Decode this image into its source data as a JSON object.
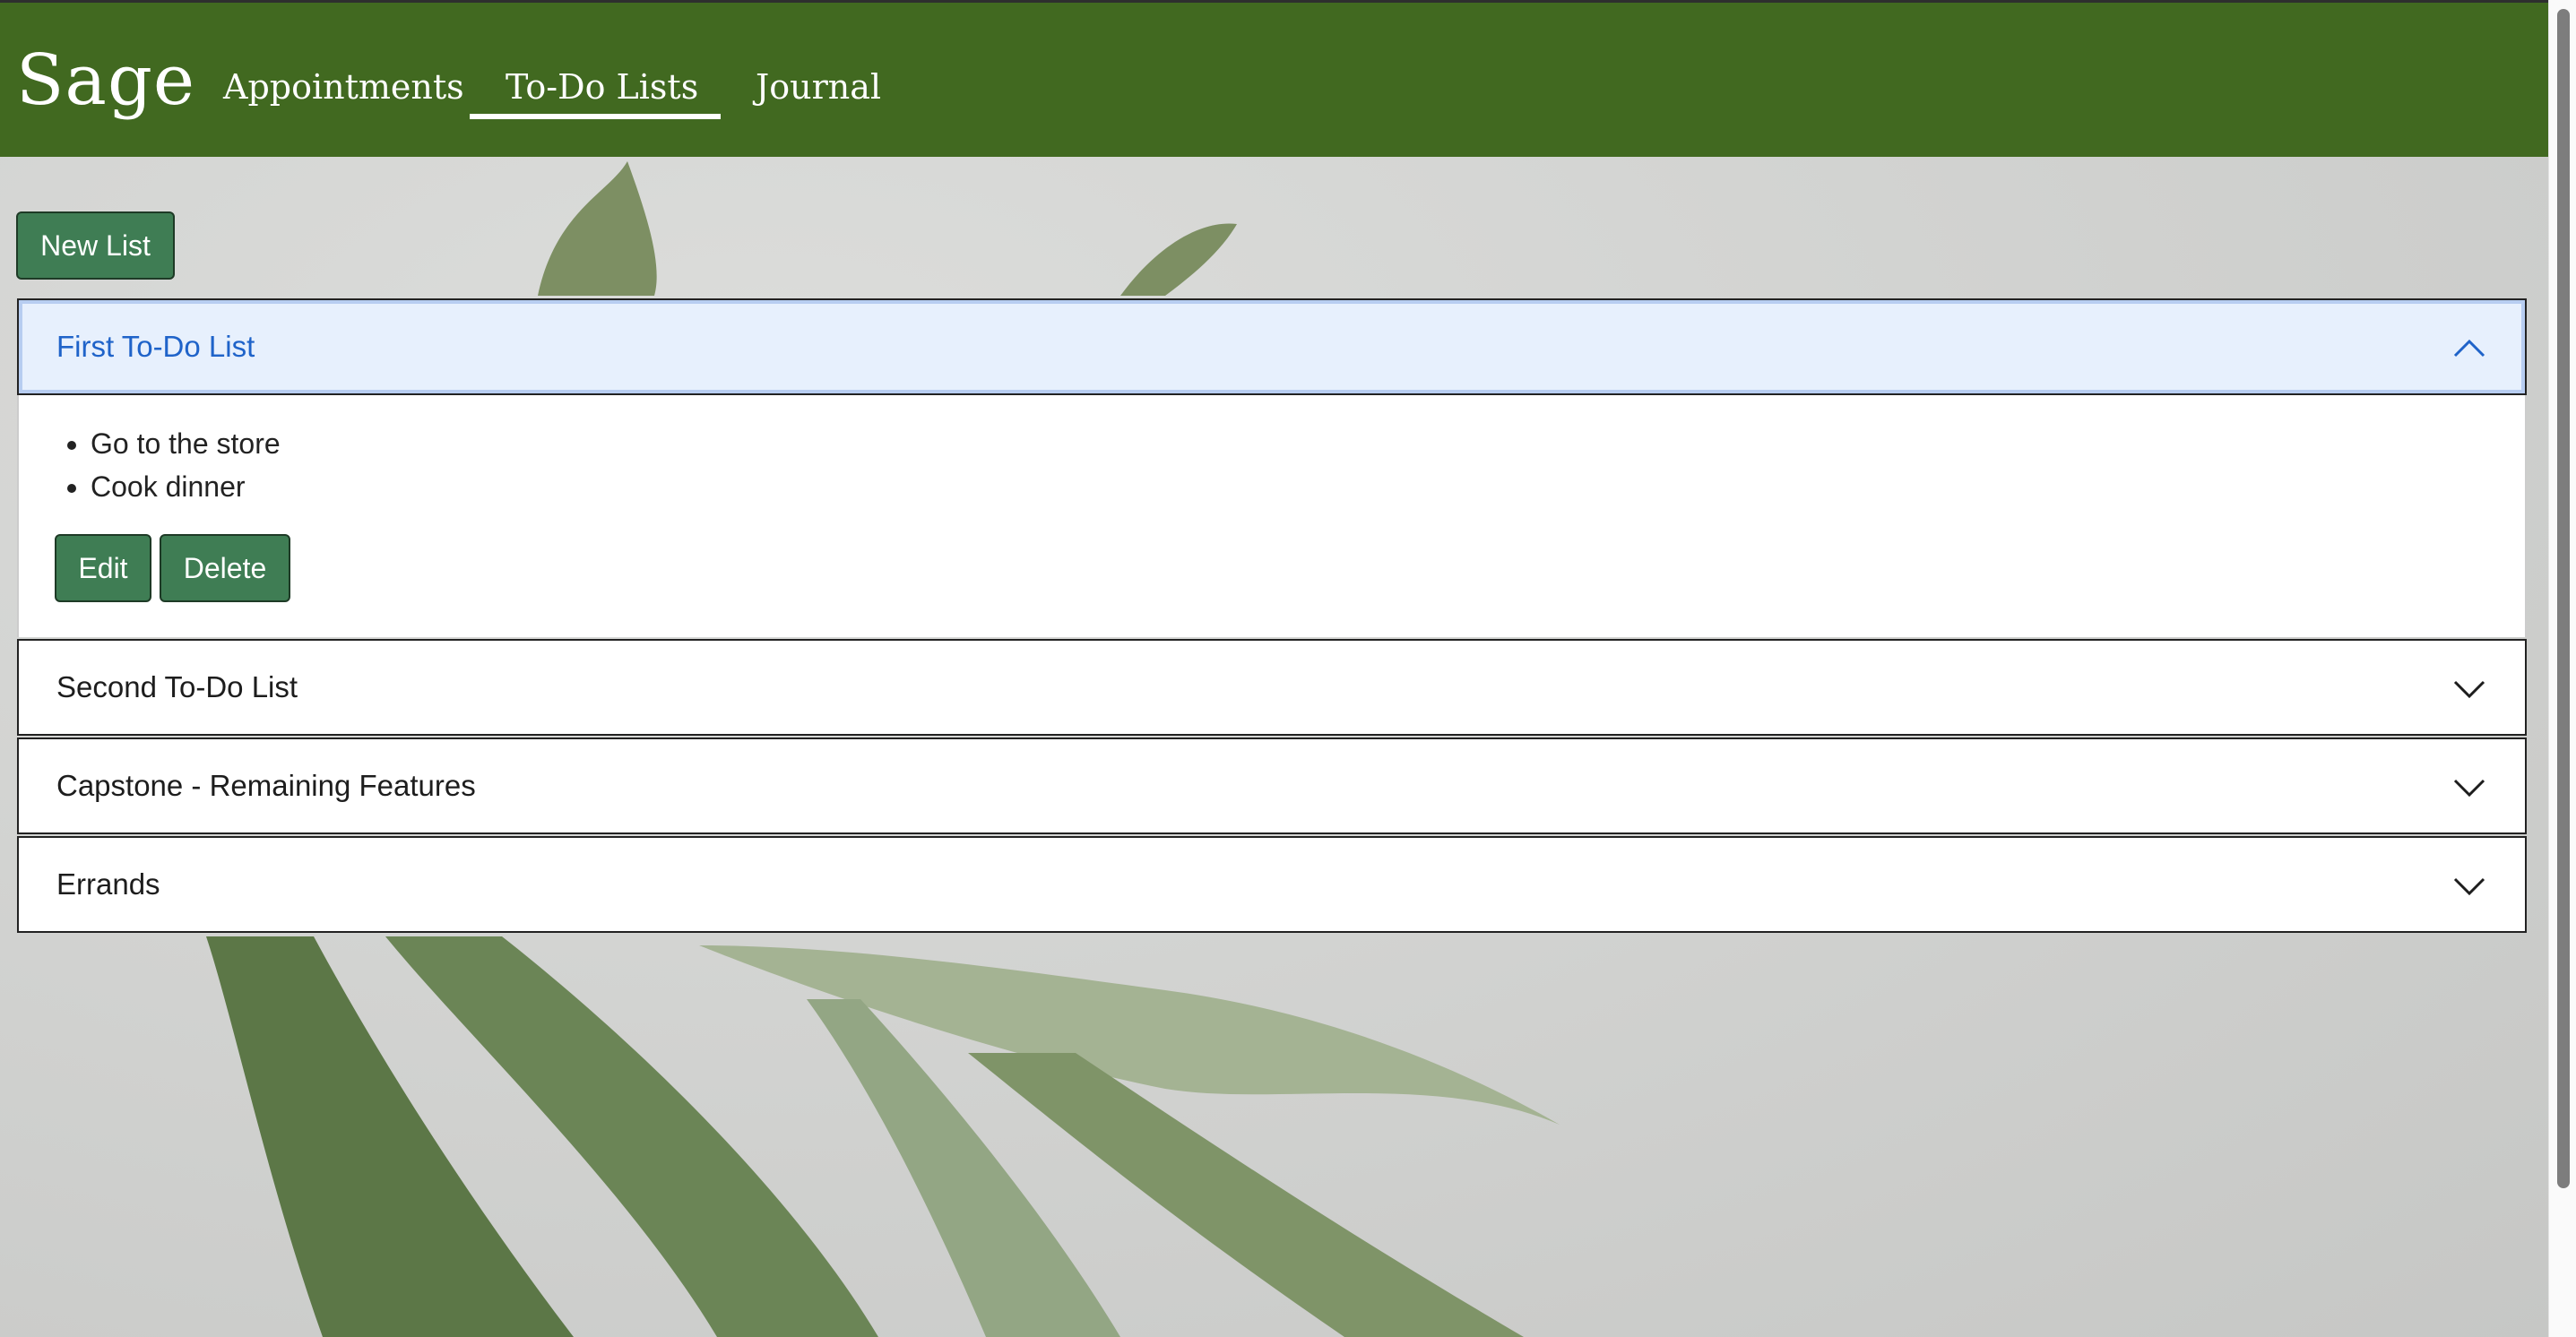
{
  "app": {
    "brand": "Sage"
  },
  "nav": {
    "items": [
      {
        "label": "Appointments",
        "active": false
      },
      {
        "label": "To-Do Lists",
        "active": true
      },
      {
        "label": "Journal",
        "active": false
      }
    ]
  },
  "toolbar": {
    "new_list_label": "New List"
  },
  "lists": [
    {
      "title": "First To-Do List",
      "expanded": true,
      "items": [
        "Go to the store",
        "Cook dinner"
      ],
      "edit_label": "Edit",
      "delete_label": "Delete"
    },
    {
      "title": "Second To-Do List",
      "expanded": false
    },
    {
      "title": "Capstone - Remaining Features",
      "expanded": false
    },
    {
      "title": "Errands",
      "expanded": false
    }
  ],
  "colors": {
    "navbar": "#416920",
    "button": "#3f7d54",
    "open_header_bg": "#e7f0fd",
    "open_header_text": "#1f63c9"
  },
  "icons": {
    "expanded": "chevron-up-icon",
    "collapsed": "chevron-down-icon"
  }
}
